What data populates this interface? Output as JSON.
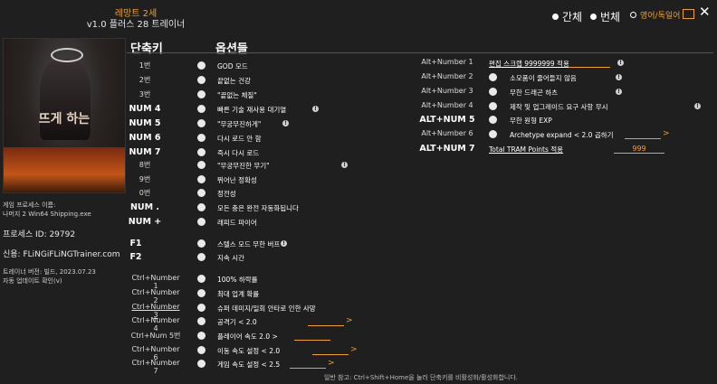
{
  "header": {
    "brand": "레망트 2세",
    "version": "v1.0 플러스 28 트레이너"
  },
  "lang": {
    "opt1": "간체",
    "opt2": "번체",
    "opt3": "영어/독일어"
  },
  "cover": {
    "title": "뜨게 하는"
  },
  "info": {
    "process_label": "게임 프로세스 이름:",
    "process_name": "나머지 2 Win64 Shipping.exe",
    "pid": "프로세스 ID: 29792",
    "credit": "신용: FLiNGiFLiNGTrainer.com",
    "trainer_version": "트레이너 버전: 빌드, 2023.07.23",
    "update": "자동 업데이트 확인(v)"
  },
  "columns": {
    "hotkey": "단축키",
    "options": "옵션들"
  },
  "left_rows": [
    {
      "key": "1번",
      "label": "GOD 모드",
      "info": false
    },
    {
      "key": "2번",
      "label": "끝없는 건강",
      "info": false
    },
    {
      "key": "3번",
      "label": "\"끝없는 체질\"",
      "info": false
    },
    {
      "key": "NUM 4",
      "label": "빠른 기술 재사용 대기열",
      "info": true
    },
    {
      "key": "NUM 5",
      "label": "\"무궁무진하게\"",
      "info": true
    },
    {
      "key": "NUM 6",
      "label": "다시 로드 안 함",
      "info": false
    },
    {
      "key": "NUM 7",
      "label": "즉시 다시 로드",
      "info": false
    },
    {
      "key": "8번",
      "label": "\"무궁무진한 무기\"",
      "info": true
    },
    {
      "key": "9번",
      "label": "뛰어난 정확성",
      "info": false
    },
    {
      "key": "0번",
      "label": "정전성",
      "info": false
    },
    {
      "key": "NUM .",
      "label": "모든 충은 완전 자동화됩니다",
      "info": false
    },
    {
      "key": "NUM +",
      "label": "래피드 파이어",
      "info": false
    }
  ],
  "f_rows": [
    {
      "key": "F1",
      "label": "스텔스 모드 무한 버프",
      "info": true
    },
    {
      "key": "F2",
      "label": "지속 시간",
      "info": false
    }
  ],
  "ctrl_rows": [
    {
      "key": "Ctrl+Number 1",
      "label": "100% 하락률",
      "value": "",
      "arrow": false
    },
    {
      "key": "Ctrl+Number 2",
      "label": "최대 업계 확률",
      "value": "",
      "arrow": false
    },
    {
      "key": "Ctrl+Number 3",
      "label": "슈퍼 데미지/일회 안타로 인한 사망",
      "value": "",
      "arrow": false
    },
    {
      "key": "Ctrl+Number 4",
      "label": "공격기 < 2.0",
      "value": "",
      "arrow": true
    },
    {
      "key": "Ctrl+Num 5번",
      "label": "플레이어 속도 2.0 >",
      "value": "",
      "arrow": false
    },
    {
      "key": "Ctrl+Number 6",
      "label": "이동 속도 설정 < 2.0",
      "value": "",
      "arrow": true
    },
    {
      "key": "Ctrl+Number 7",
      "label": "게임 속도 설정 < 2.5",
      "value": "",
      "arrow": true
    }
  ],
  "right_rows": [
    {
      "key": "Alt+Number 1",
      "label": "편집 스크랩 9999999 적용",
      "toggle": false,
      "value": "",
      "info": true
    },
    {
      "key": "Alt+Number 2",
      "label": "소모품이 줄어들지 않음",
      "toggle": true,
      "value": "",
      "info": true
    },
    {
      "key": "Alt+Number 3",
      "label": "무한 드래곤 하츠",
      "toggle": true,
      "value": "",
      "info": true
    },
    {
      "key": "Alt+Number 4",
      "label": "제작 및 업그레이드 요구 사항 무시",
      "toggle": true,
      "value": "",
      "info": true
    },
    {
      "key": "ALT+NUM 5",
      "label": "무한 원형 EXP",
      "toggle": true,
      "value": "",
      "info": false
    },
    {
      "key": "Alt+Number 6",
      "label": "Archetype expand < 2.0 곱하기",
      "toggle": true,
      "value": "",
      "info": false
    },
    {
      "key": "ALT+NUM 7",
      "label": "Total TRAM Points 적용",
      "toggle": false,
      "value": "999",
      "info": false
    }
  ],
  "footer": "일반 참고: Ctrl+Shift+Home을 눌러 단축키를 비활성화/활성화합니다.",
  "colors": {
    "accent": "#f0a030",
    "bg": "#1f1f1f"
  }
}
